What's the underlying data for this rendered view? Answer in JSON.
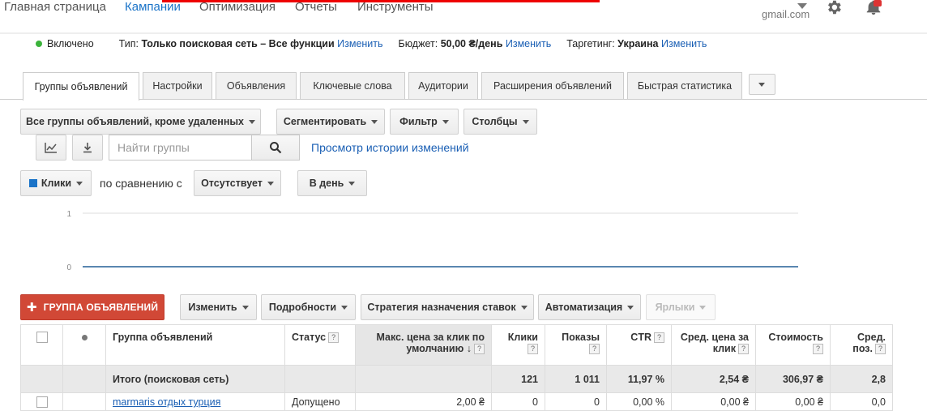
{
  "topnav": {
    "items": [
      "Главная страница",
      "Кампании",
      "Оптимизация",
      "Отчеты",
      "Инструменты"
    ],
    "account": "gmail.com"
  },
  "campaign_status": {
    "state": "Включено",
    "type_label": "Тип:",
    "type_value": "Только поисковая сеть – Все функции",
    "type_edit": "Изменить",
    "budget_label": "Бюджет:",
    "budget_value": "50,00 ₴/день",
    "budget_edit": "Изменить",
    "targeting_label": "Таргетинг:",
    "targeting_value": "Украина",
    "targeting_edit": "Изменить"
  },
  "tabs": [
    "Группы объявлений",
    "Настройки",
    "Объявления",
    "Ключевые слова",
    "Аудитории",
    "Расширения объявлений",
    "Быстрая статистика"
  ],
  "toolbar": {
    "filter_scope": "Все группы объявлений, кроме удаленных",
    "segment": "Сегментировать",
    "filter": "Фильтр",
    "columns": "Столбцы",
    "search_placeholder": "Найти группы",
    "history_link": "Просмотр истории изменений",
    "metric": "Клики",
    "compare_text": "по сравнению с",
    "compare_value": "Отсутствует",
    "period": "В день"
  },
  "chart_data": {
    "type": "line",
    "yticks": [
      "1",
      "0"
    ],
    "ylim": [
      0,
      1
    ],
    "series": [
      {
        "values": [
          0,
          0
        ]
      }
    ]
  },
  "actions": {
    "add_group": "ГРУППА ОБЪЯВЛЕНИЙ",
    "edit": "Изменить",
    "details": "Подробности",
    "bid_strategy": "Стратегия назначения ставок",
    "automation": "Автоматизация",
    "labels": "Ярлыки"
  },
  "table": {
    "headers": {
      "group": "Группа объявлений",
      "status": "Статус",
      "max_cpc": "Макс. цена за клик по умолчанию",
      "clicks": "Клики",
      "impressions": "Показы",
      "ctr": "CTR",
      "avg_cpc": "Сред. цена за клик",
      "cost": "Стоимость",
      "avg_pos": "Сред. поз."
    },
    "help_mark": "?",
    "total": {
      "label": "Итого (поисковая сеть)",
      "clicks": "121",
      "impressions": "1 011",
      "ctr": "11,97 %",
      "avg_cpc": "2,54 ₴",
      "cost": "306,97 ₴",
      "avg_pos": "2,8"
    },
    "row1": {
      "name": "marmaris отдых турция",
      "status": "Допущено",
      "max_cpc": "2,00 ₴",
      "clicks": "0",
      "impressions": "0",
      "ctr": "0,00 %",
      "avg_cpc": "0,00 ₴",
      "cost": "0,00 ₴",
      "avg_pos": "0,0"
    }
  }
}
